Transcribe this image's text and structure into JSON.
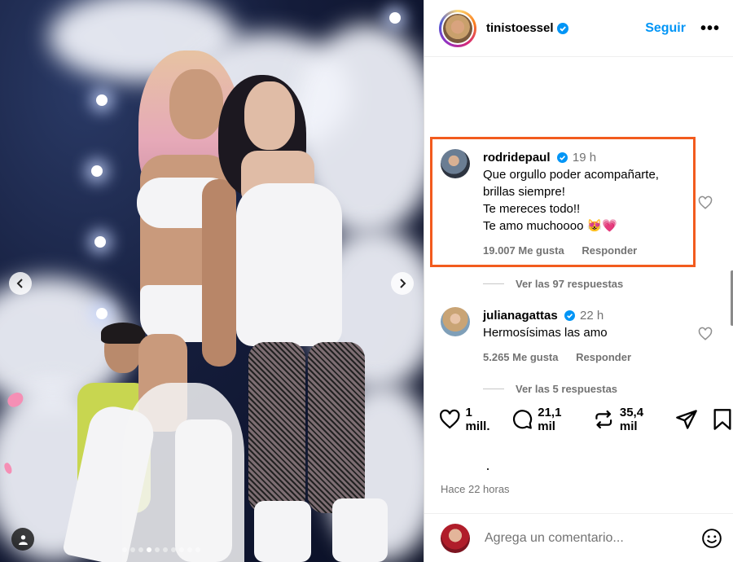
{
  "post": {
    "username": "tinistoessel",
    "follow_label": "Seguir",
    "more_label": "•••",
    "carousel_count": 10,
    "carousel_active": 3
  },
  "comments": [
    {
      "username": "rodridepaul",
      "time": "19 h",
      "lines": [
        "Que orgullo poder acompañarte,",
        "brillas siempre!",
        "Te mereces todo!!",
        "Te amo muchoooo 😻💗"
      ],
      "likes": "19.007 Me gusta",
      "reply_label": "Responder",
      "view_replies": "Ver las 97 respuestas",
      "highlighted": true
    },
    {
      "username": "julianagattas",
      "time": "22 h",
      "lines": [
        "Hermosísimas las amo"
      ],
      "likes": "5.265 Me gusta",
      "reply_label": "Responder",
      "view_replies": "Ver las 5 respuestas",
      "highlighted": false
    }
  ],
  "actions": {
    "likes": "1 mill.",
    "comments": "21,1 mil",
    "reposts": "35,4 mil"
  },
  "timestamp": "Hace 22 horas",
  "footer": {
    "placeholder": "Agrega un comentario..."
  },
  "colors": {
    "accent": "#0095f6",
    "highlight_border": "#f25b1e",
    "muted": "#737373"
  },
  "icons": [
    "chevron-left-icon",
    "chevron-right-icon",
    "user-tag-icon",
    "verified-icon",
    "heart-icon",
    "comment-icon",
    "repost-icon",
    "share-icon",
    "bookmark-icon",
    "emoji-icon"
  ]
}
